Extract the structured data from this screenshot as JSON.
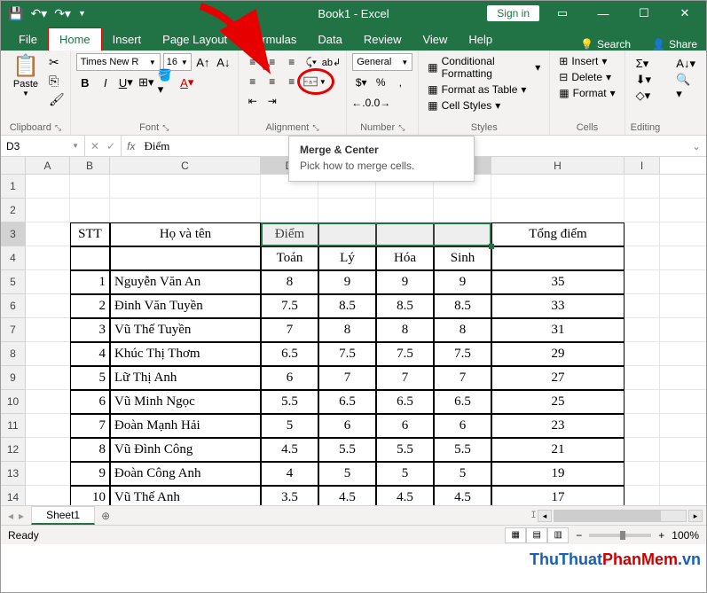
{
  "title": "Book1 - Excel",
  "signin": "Sign in",
  "tabs": [
    "File",
    "Home",
    "Insert",
    "Page Layout",
    "Formulas",
    "Data",
    "Review",
    "View",
    "Help"
  ],
  "active_tab": "Home",
  "tell_me": "Search",
  "share": "Share",
  "clipboard": {
    "label": "Clipboard",
    "paste": "Paste"
  },
  "font": {
    "label": "Font",
    "name": "Times New R",
    "size": "16"
  },
  "alignment": {
    "label": "Alignment"
  },
  "number": {
    "label": "Number",
    "format": "General"
  },
  "styles": {
    "label": "Styles",
    "cond": "Conditional Formatting",
    "table": "Format as Table",
    "cell": "Cell Styles"
  },
  "cells_grp": {
    "label": "Cells",
    "insert": "Insert",
    "delete": "Delete",
    "format": "Format"
  },
  "editing": {
    "label": "Editing"
  },
  "tooltip": {
    "title": "Merge & Center",
    "desc": "Pick how to merge cells."
  },
  "name_box": "D3",
  "formula_value": "Điểm",
  "columns": [
    "A",
    "B",
    "C",
    "D",
    "E",
    "F",
    "G",
    "H",
    "I"
  ],
  "headers_row3": {
    "stt": "STT",
    "hoten": "Họ và tên",
    "diem": "Điểm",
    "tongdiem": "Tổng điểm"
  },
  "headers_row4": [
    "Toán",
    "Lý",
    "Hóa",
    "Sinh"
  ],
  "data_rows": [
    {
      "n": "1",
      "name": "Nguyễn Văn An",
      "s": [
        "8",
        "9",
        "9",
        "9"
      ],
      "t": "35"
    },
    {
      "n": "2",
      "name": "Đinh Văn Tuyền",
      "s": [
        "7.5",
        "8.5",
        "8.5",
        "8.5"
      ],
      "t": "33"
    },
    {
      "n": "3",
      "name": "Vũ Thế Tuyền",
      "s": [
        "7",
        "8",
        "8",
        "8"
      ],
      "t": "31"
    },
    {
      "n": "4",
      "name": "Khúc Thị Thơm",
      "s": [
        "6.5",
        "7.5",
        "7.5",
        "7.5"
      ],
      "t": "29"
    },
    {
      "n": "5",
      "name": "Lữ Thị Anh",
      "s": [
        "6",
        "7",
        "7",
        "7"
      ],
      "t": "27"
    },
    {
      "n": "6",
      "name": "Vũ Minh Ngọc",
      "s": [
        "5.5",
        "6.5",
        "6.5",
        "6.5"
      ],
      "t": "25"
    },
    {
      "n": "7",
      "name": "Đoàn Mạnh Hải",
      "s": [
        "5",
        "6",
        "6",
        "6"
      ],
      "t": "23"
    },
    {
      "n": "8",
      "name": "Vũ Đình Công",
      "s": [
        "4.5",
        "5.5",
        "5.5",
        "5.5"
      ],
      "t": "21"
    },
    {
      "n": "9",
      "name": "Đoàn Công Anh",
      "s": [
        "4",
        "5",
        "5",
        "5"
      ],
      "t": "19"
    },
    {
      "n": "10",
      "name": "Vũ Thế Anh",
      "s": [
        "3.5",
        "4.5",
        "4.5",
        "4.5"
      ],
      "t": "17"
    }
  ],
  "sheet_tab": "Sheet1",
  "status": "Ready",
  "zoom": "100%",
  "watermark": {
    "a": "ThuThuat",
    "b": "PhanMem",
    "c": ".vn"
  }
}
